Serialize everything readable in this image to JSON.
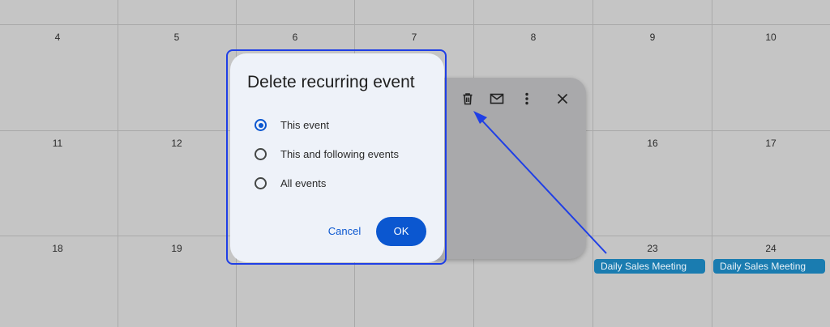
{
  "calendar": {
    "week1": [
      "4",
      "5",
      "6",
      "7",
      "8",
      "9",
      "10"
    ],
    "week2": [
      "11",
      "12",
      "16",
      "17"
    ],
    "week3": [
      "18",
      "19",
      "23",
      "24"
    ],
    "events": [
      "Daily Sales Meeting",
      "Daily Sales Meeting"
    ]
  },
  "popover": {
    "icons": [
      "trash-icon",
      "mail-icon",
      "more-vertical-icon",
      "close-icon"
    ]
  },
  "dialog": {
    "title": "Delete recurring event",
    "options": [
      {
        "label": "This event",
        "selected": true
      },
      {
        "label": "This and following events",
        "selected": false
      },
      {
        "label": "All events",
        "selected": false
      }
    ],
    "cancel_label": "Cancel",
    "ok_label": "OK"
  },
  "colors": {
    "accent": "#0b57d0",
    "annotation": "#1f3fe6",
    "event": "#1a7cb0"
  }
}
